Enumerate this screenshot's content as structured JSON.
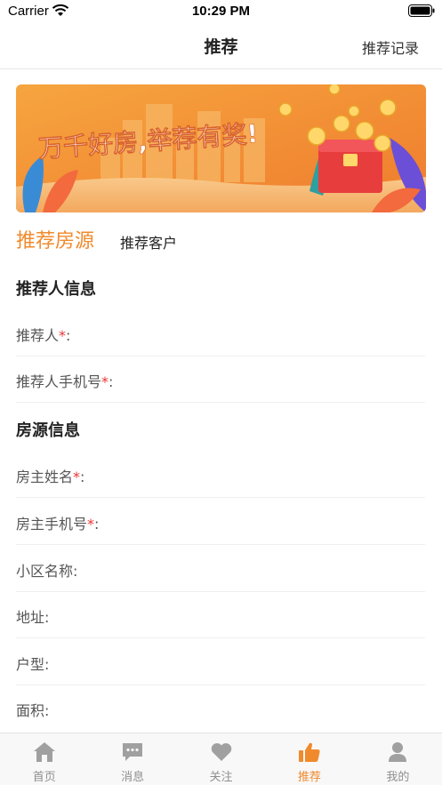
{
  "status_bar": {
    "carrier": "Carrier",
    "time": "10:29 PM"
  },
  "nav": {
    "title": "推荐",
    "right_link": "推荐记录"
  },
  "banner": {
    "slogan": "万千好房,举荐有奖!"
  },
  "tabs": {
    "active": "推荐房源",
    "inactive": "推荐客户"
  },
  "recommender_section": {
    "title": "推荐人信息",
    "fields": [
      {
        "label": "推荐人",
        "required": "*",
        "colon": ":",
        "value": ""
      },
      {
        "label": "推荐人手机号",
        "required": "*",
        "colon": ":",
        "value": ""
      }
    ]
  },
  "property_section": {
    "title": "房源信息",
    "fields": [
      {
        "label": "房主姓名",
        "required": "*",
        "colon": ":",
        "value": ""
      },
      {
        "label": "房主手机号",
        "required": "*",
        "colon": ":",
        "value": ""
      },
      {
        "label": "小区名称",
        "required": "",
        "colon": ":",
        "value": ""
      },
      {
        "label": "地址",
        "required": "",
        "colon": ":",
        "value": ""
      },
      {
        "label": "户型",
        "required": "",
        "colon": ":",
        "value": ""
      },
      {
        "label": "面积",
        "required": "",
        "colon": ":",
        "value": ""
      }
    ]
  },
  "tab_bar": {
    "items": [
      {
        "label": "首页",
        "icon": "home-icon"
      },
      {
        "label": "消息",
        "icon": "message-icon"
      },
      {
        "label": "关注",
        "icon": "heart-icon"
      },
      {
        "label": "推荐",
        "icon": "thumbs-up-icon"
      },
      {
        "label": "我的",
        "icon": "user-icon"
      }
    ]
  },
  "colors": {
    "accent": "#f08a2c",
    "required": "#e33333",
    "tab_inactive": "#8f8f8f"
  }
}
